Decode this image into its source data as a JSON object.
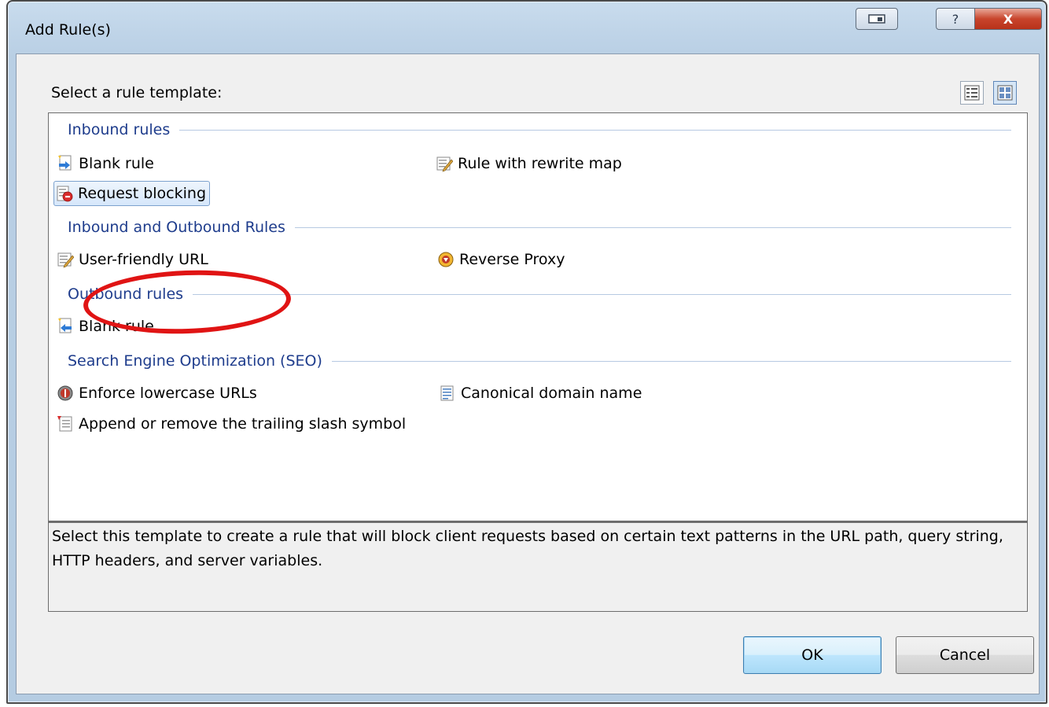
{
  "window": {
    "title": "Add Rule(s)",
    "help_glyph": "?",
    "close_glyph": "X"
  },
  "dialog": {
    "select_label": "Select a rule template:",
    "description": "Select this template to create a rule that will block client requests based on certain text patterns in the URL path, query string, HTTP headers, and server variables.",
    "ok_label": "OK",
    "cancel_label": "Cancel"
  },
  "groups": {
    "inbound": {
      "header": "Inbound rules",
      "items": [
        "Blank rule",
        "Rule with rewrite map",
        "Request blocking"
      ]
    },
    "inbound_outbound": {
      "header": "Inbound and Outbound Rules",
      "items": [
        "User-friendly URL",
        "Reverse Proxy"
      ]
    },
    "outbound": {
      "header": "Outbound rules",
      "items": [
        "Blank rule"
      ]
    },
    "seo": {
      "header": "Search Engine Optimization (SEO)",
      "items": [
        "Enforce lowercase URLs",
        "Canonical domain name",
        "Append or remove the trailing slash symbol"
      ]
    }
  },
  "selected_item": "Request blocking",
  "colors": {
    "group_header": "#1e3c8c",
    "annotation": "#e01414",
    "selection": "#d6e7fb"
  }
}
